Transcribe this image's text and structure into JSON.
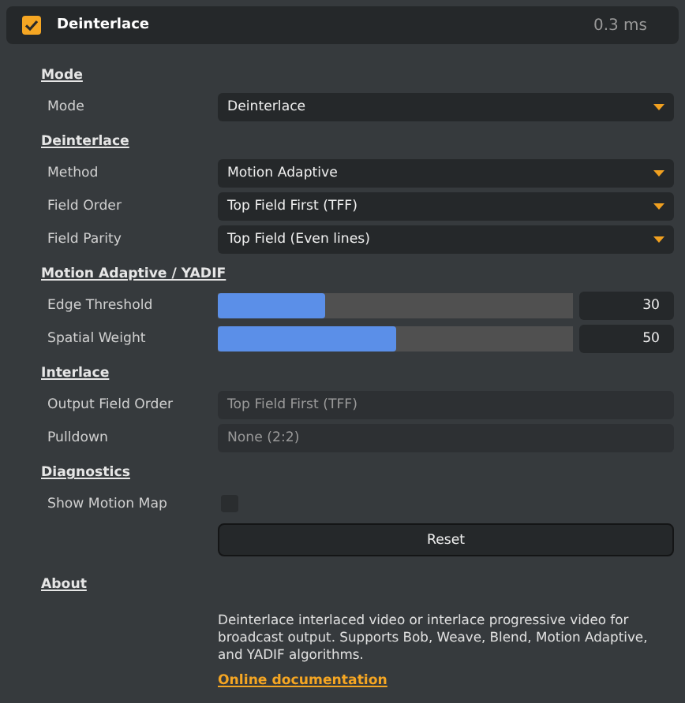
{
  "header": {
    "enabled": true,
    "title": "Deinterlace",
    "timing": "0.3 ms"
  },
  "sections": [
    {
      "title": "Mode",
      "rows": [
        {
          "kind": "select",
          "label": "Mode",
          "value": "Deinterlace"
        }
      ]
    },
    {
      "title": "Deinterlace",
      "rows": [
        {
          "kind": "select",
          "label": "Method",
          "value": "Motion Adaptive"
        },
        {
          "kind": "select",
          "label": "Field Order",
          "value": "Top Field First (TFF)"
        },
        {
          "kind": "select",
          "label": "Field Parity",
          "value": "Top Field (Even lines)"
        }
      ]
    },
    {
      "title": "Motion Adaptive / YADIF",
      "rows": [
        {
          "kind": "slider",
          "label": "Edge Threshold",
          "level": 0.3,
          "value": "30"
        },
        {
          "kind": "slider",
          "label": "Spatial Weight",
          "level": 0.5,
          "value": "50"
        }
      ]
    },
    {
      "title": "Interlace",
      "rows": [
        {
          "kind": "readonly",
          "label": "Output Field Order",
          "value": "Top Field First (TFF)"
        },
        {
          "kind": "readonly",
          "label": "Pulldown",
          "value": "None (2:2)"
        }
      ]
    },
    {
      "title": "Diagnostics",
      "rows": [
        {
          "kind": "checkbox",
          "label": "Show Motion Map",
          "checked": false
        },
        {
          "kind": "button",
          "value": "Reset"
        }
      ]
    }
  ],
  "about": {
    "title": "About",
    "text": "Deinterlace interlaced video or interlace progressive video for broadcast output. Supports Bob, Weave, Blend, Motion Adaptive, and YADIF algorithms.",
    "link": "Online documentation"
  }
}
